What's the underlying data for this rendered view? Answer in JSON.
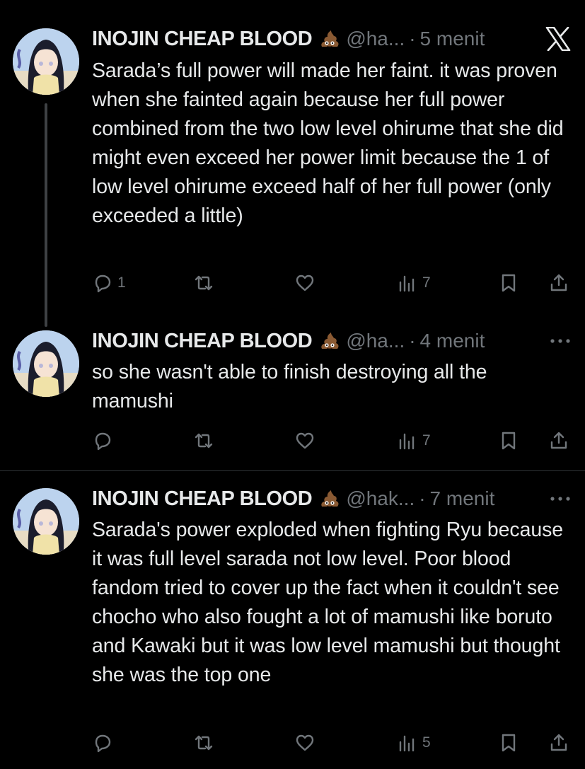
{
  "tweets": [
    {
      "name": "INOJIN CHEAP BLOOD",
      "handle": "@ha...",
      "separator": "·",
      "time": "5 menit",
      "text": "Sarada’s full power will made her faint. it was proven when she fainted again because her full power combined from the two low level ohirume that she did might even exceed her power limit because the 1 of low level ohirume exceed half of her full power (only exceeded a little)",
      "replies": "1",
      "views": "7",
      "top_right_icon": "x-logo-icon"
    },
    {
      "name": "INOJIN CHEAP BLOOD",
      "handle": "@ha...",
      "separator": "·",
      "time": "4 menit",
      "text": "so she wasn't able to finish destroying all the mamushi",
      "replies": "",
      "views": "7",
      "top_right_icon": "more-icon"
    },
    {
      "name": "INOJIN CHEAP BLOOD",
      "handle": "@hak...",
      "separator": "·",
      "time": "7 menit",
      "text": "Sarada's power exploded when fighting Ryu because it was full level sarada not low level. Poor blood fandom tried to cover up the fact when it couldn't see chocho who also fought a lot of mamushi like boruto and Kawaki but it was low level mamushi but thought she was the top one",
      "replies": "",
      "views": "5",
      "top_right_icon": "more-icon"
    }
  ],
  "colors": {
    "background": "#000000",
    "text": "#e7e9ea",
    "secondary": "#71767b",
    "divider": "#2f3336"
  }
}
